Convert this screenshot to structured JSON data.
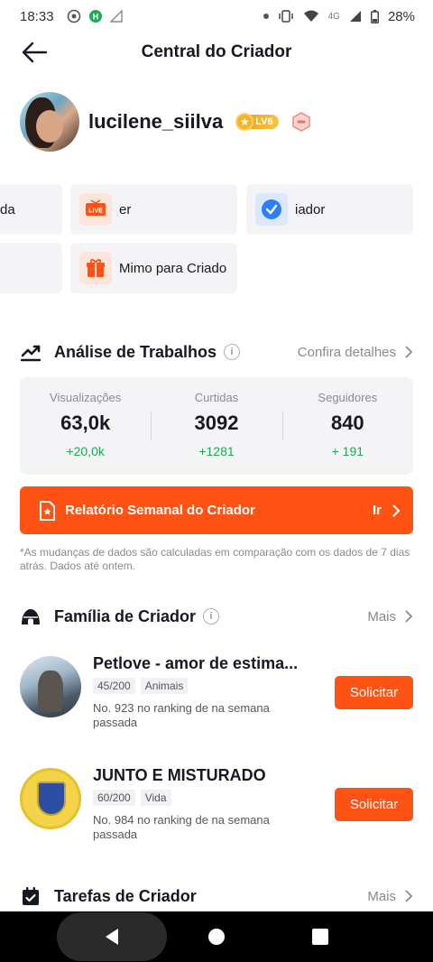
{
  "status_bar": {
    "time": "18:33",
    "network": "4G",
    "battery": "28%"
  },
  "header": {
    "title": "Central do Criador"
  },
  "profile": {
    "username": "lucilene_siilva",
    "level": "LV6"
  },
  "tools": [
    {
      "label": "da"
    },
    {
      "label": "er",
      "icon_text": "LIVE"
    },
    {
      "label": "iador"
    },
    {
      "label": ""
    },
    {
      "label": "Mimo para Criado"
    }
  ],
  "analysis": {
    "title": "Análise de Trabalhos",
    "more": "Confira detalhes",
    "stats": [
      {
        "label": "Visualizações",
        "value": "63,0k",
        "delta": "+20,0k"
      },
      {
        "label": "Curtidas",
        "value": "3092",
        "delta": "+1281"
      },
      {
        "label": "Seguidores",
        "value": "840",
        "delta": "+ 191"
      }
    ]
  },
  "report": {
    "title": "Relatório Semanal do Criador",
    "go": "Ir"
  },
  "footnote": "*As mudanças de dados são calculadas em comparação com os dados de 7 dias atrás. Dados até ontem.",
  "family": {
    "title": "Família de Criador",
    "more": "Mais",
    "items": [
      {
        "name": "Petlove - amor de estima...",
        "members": "45/200",
        "category": "Animais",
        "rank": "No. 923 no ranking de na semana passada",
        "button": "Solicitar"
      },
      {
        "name": "JUNTO E MISTURADO",
        "members": "60/200",
        "category": "Vida",
        "rank": "No. 984 no ranking de na semana passada",
        "button": "Solicitar"
      }
    ]
  },
  "tasks": {
    "title": "Tarefas de Criador",
    "more": "Mais"
  },
  "colors": {
    "accent": "#fe5314",
    "positive": "#1fa855",
    "card_bg": "#f4f4f6",
    "muted_text": "#8a8b91"
  }
}
